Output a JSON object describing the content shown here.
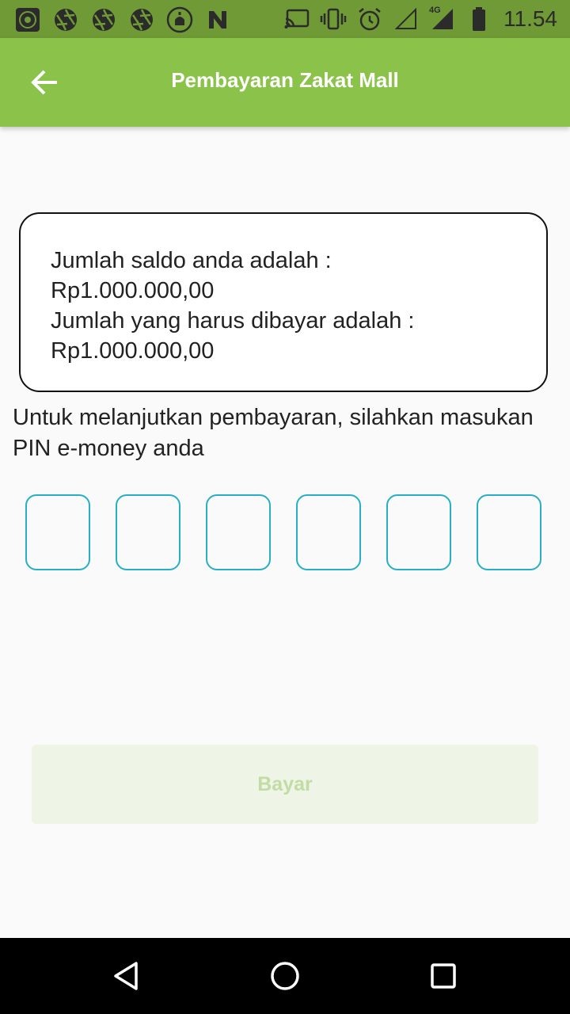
{
  "status_bar": {
    "time": "11.54",
    "network": "4G",
    "left_icons": [
      "quran-app-icon",
      "aperture-icon",
      "aperture-icon",
      "aperture-icon",
      "mosque-icon",
      "n-app-icon"
    ],
    "right_icons": [
      "cast-icon",
      "vibrate-icon",
      "alarm-icon",
      "signal-empty-icon",
      "signal-4g-icon",
      "battery-icon"
    ]
  },
  "app_bar": {
    "title": "Pembayaran Zakat Mall",
    "back_icon": "arrow-left-icon"
  },
  "info": {
    "balance_label": "Jumlah saldo anda adalah :",
    "balance_value": "Rp1.000.000,00",
    "due_label": "Jumlah yang harus dibayar adalah :",
    "due_value": "Rp1.000.000,00"
  },
  "prompt": "Untuk melanjutkan pembayaran, silahkan masukan PIN e-money anda",
  "pin": {
    "length": 6,
    "values": [
      "",
      "",
      "",
      "",
      "",
      ""
    ]
  },
  "pay_button": {
    "label": "Bayar"
  },
  "nav_bar": {
    "icons": [
      "back-triangle-icon",
      "home-circle-icon",
      "recents-square-icon"
    ]
  },
  "colors": {
    "status_bar": "#6f9a35",
    "app_bar": "#8bc34a",
    "pin_border": "#26b0c8",
    "button_bg": "#eef4e6",
    "button_text": "#c2dca4"
  }
}
